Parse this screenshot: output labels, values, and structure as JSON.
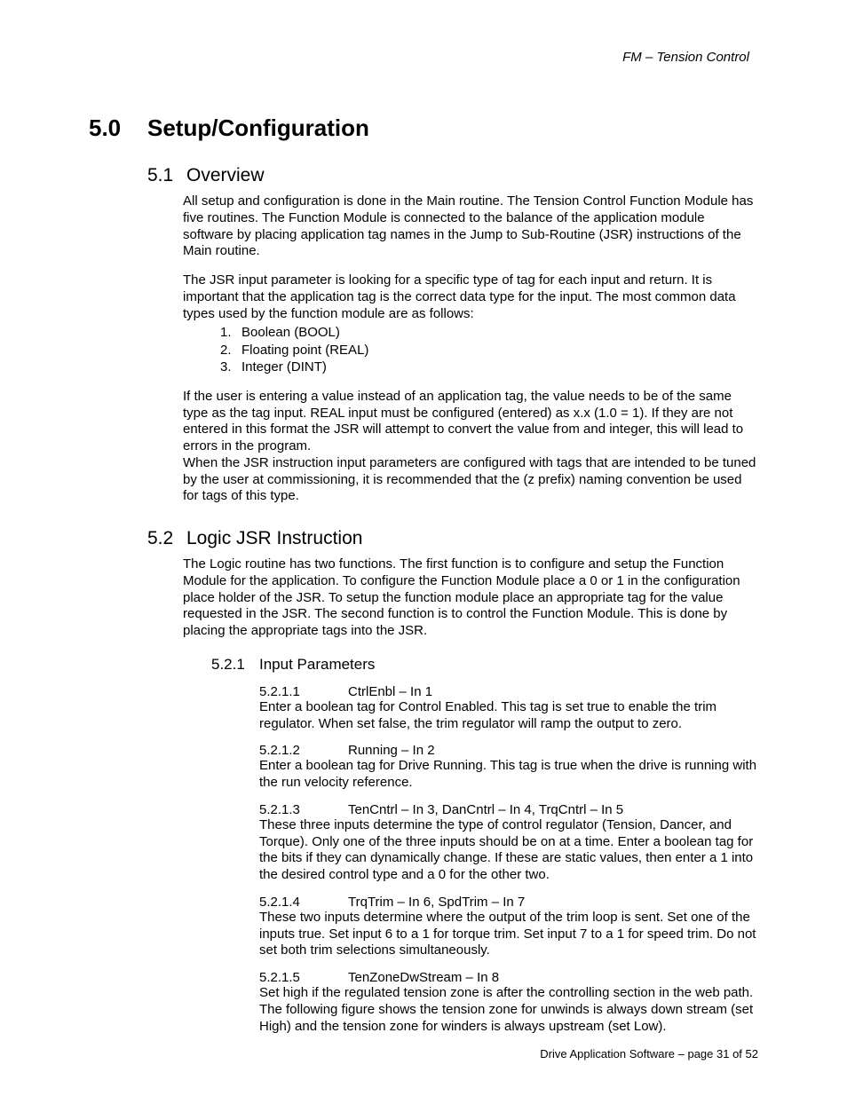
{
  "header": {
    "right": "FM – Tension Control"
  },
  "h1": {
    "num": "5.0",
    "title": "Setup/Configuration"
  },
  "s51": {
    "num": "5.1",
    "title": "Overview",
    "p1": "All setup and configuration is done in the Main routine.  The Tension Control Function Module has five routines.  The Function Module is connected to the balance of the application module software by placing application tag names in the Jump to Sub-Routine (JSR) instructions of the Main routine.",
    "p2": "The JSR input parameter is looking for a specific type of tag for each input and return.  It is important that the application tag is the correct data type for the input. The most common data types used by the function module are as follows:",
    "list": [
      {
        "n": "1.",
        "t": "Boolean   (BOOL)"
      },
      {
        "n": "2.",
        "t": "Floating point (REAL)"
      },
      {
        "n": "3.",
        "t": "Integer (DINT)"
      }
    ],
    "p3": "If the user is entering a value instead of an application tag, the value needs to be of the same type as the tag input.  REAL input must be configured (entered) as x.x (1.0 = 1).  If they are not entered in this format the JSR will attempt to convert the value from and integer, this will lead to errors in the program.",
    "p4": "When the JSR instruction input parameters are configured with tags that are intended to be tuned by the user at commissioning, it is recommended that the (z prefix) naming convention be used for tags of this type."
  },
  "s52": {
    "num": "5.2",
    "title": "Logic JSR Instruction",
    "p1": "The Logic routine has two functions.  The first function is to configure and setup the Function Module for the application.  To configure the Function Module place a 0 or 1 in the configuration place holder of the JSR.  To setup the function module place an appropriate tag for the value requested in the JSR.  The second function is to control the Function Module.  This is done by placing the appropriate tags into the JSR.",
    "s521": {
      "num": "5.2.1",
      "title": "Input Parameters",
      "items": [
        {
          "num": "5.2.1.1",
          "title": "CtrlEnbl – In 1",
          "body": "Enter a boolean tag for Control Enabled.  This tag is set true to enable the trim regulator.  When set false, the trim regulator will ramp the output to zero."
        },
        {
          "num": "5.2.1.2",
          "title": "Running – In 2",
          "body": "Enter a boolean tag for Drive Running.  This tag is true when the drive is running with the run velocity reference."
        },
        {
          "num": "5.2.1.3",
          "title": "TenCntrl – In 3, DanCntrl – In 4, TrqCntrl – In 5",
          "body": "These three inputs determine the type of control regulator (Tension, Dancer, and Torque).  Only one of the three inputs should be on at a time.  Enter a boolean tag for the bits if they can dynamically change.  If these are static values, then enter a 1 into the desired control type and a 0 for the other two."
        },
        {
          "num": "5.2.1.4",
          "title": "TrqTrim – In 6, SpdTrim – In 7",
          "body": "These two inputs determine where the output of the trim loop is sent.  Set one of the inputs true.  Set input 6 to a 1 for torque trim.  Set input 7 to a 1 for speed trim.  Do not set both trim selections simultaneously."
        },
        {
          "num": "5.2.1.5",
          "title": "TenZoneDwStream – In 8",
          "body": "Set high if the regulated tension zone is after the controlling section in the web path.  The following figure shows the tension zone for unwinds is always down stream (set High) and the tension zone for winders is always upstream (set Low)."
        }
      ]
    }
  },
  "footer": {
    "text": "Drive Application Software – page 31 of 52"
  }
}
